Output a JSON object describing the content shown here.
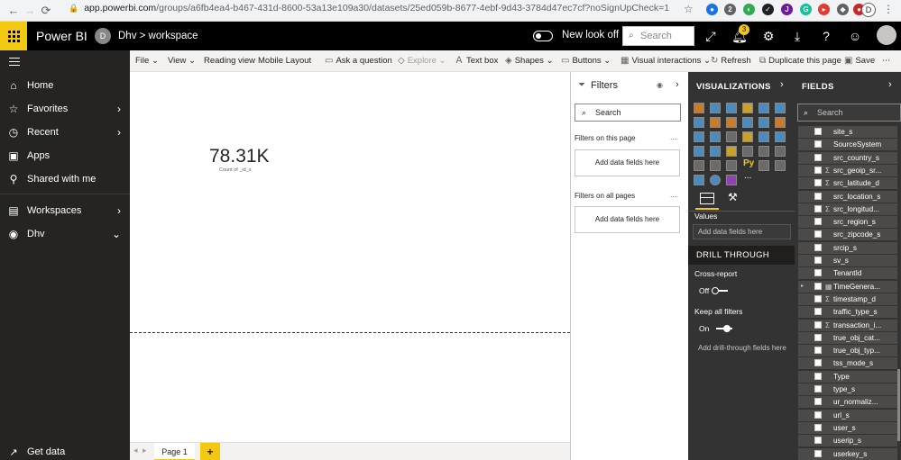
{
  "browser": {
    "url_host": "app.powerbi.com",
    "url_path": "/groups/a6fb4ea4-b467-431d-8600-53a13e109a30/datasets/25ed059b-8677-4ebf-9d43-3784d47ec7cf?noSignUpCheck=1",
    "profile_initial": "D",
    "extension_badge": "2"
  },
  "header": {
    "app_name": "Power BI",
    "workspace_avatar": "D",
    "breadcrumb": "Dhv  >  workspace",
    "new_look_label": "New look off",
    "search_placeholder": "Search",
    "notification_count": "3"
  },
  "leftnav": {
    "items": [
      {
        "label": "Home",
        "icon": "home-icon"
      },
      {
        "label": "Favorites",
        "icon": "star-icon"
      },
      {
        "label": "Recent",
        "icon": "clock-icon"
      },
      {
        "label": "Apps",
        "icon": "apps-icon"
      },
      {
        "label": "Shared with me",
        "icon": "shared-icon"
      },
      {
        "label": "Workspaces",
        "icon": "workspaces-icon"
      },
      {
        "label": "Dhv",
        "icon": "workspace-avatar-icon"
      }
    ],
    "get_data": "Get data"
  },
  "ribbon": {
    "file": "File",
    "view": "View",
    "reading_view": "Reading view",
    "mobile_layout": "Mobile Layout",
    "ask_question": "Ask a question",
    "explore": "Explore",
    "text_box": "Text box",
    "shapes": "Shapes",
    "buttons": "Buttons",
    "visual_interactions": "Visual interactions",
    "refresh": "Refresh",
    "duplicate_page": "Duplicate this page",
    "save": "Save"
  },
  "canvas": {
    "card_value": "78.31K",
    "card_label": "Count of _id_s",
    "page_tab": "Page 1",
    "add_page": "+"
  },
  "filters": {
    "title": "Filters",
    "search_placeholder": "Search",
    "on_this_page": "Filters on this page",
    "on_all_pages": "Filters on all pages",
    "add_fields": "Add data fields here",
    "more": "..."
  },
  "visualizations": {
    "title": "VISUALIZATIONS",
    "values_label": "Values",
    "values_placeholder": "Add data fields here",
    "drill_through": "DRILL THROUGH",
    "cross_report": "Cross-report",
    "cross_report_state": "Off",
    "keep_all_filters": "Keep all filters",
    "keep_all_filters_state": "On",
    "drill_placeholder": "Add drill-through fields here",
    "py_label": "Py",
    "more_visuals": "..."
  },
  "fields": {
    "title": "FIELDS",
    "search_placeholder": "Search",
    "items": [
      {
        "name": "site_s",
        "sigma": ""
      },
      {
        "name": "SourceSystem",
        "sigma": ""
      },
      {
        "name": "src_country_s",
        "sigma": ""
      },
      {
        "name": "src_geoip_sr...",
        "sigma": "Σ"
      },
      {
        "name": "src_latitude_d",
        "sigma": "Σ"
      },
      {
        "name": "src_location_s",
        "sigma": ""
      },
      {
        "name": "src_longitud...",
        "sigma": "Σ"
      },
      {
        "name": "src_region_s",
        "sigma": ""
      },
      {
        "name": "src_zipcode_s",
        "sigma": ""
      },
      {
        "name": "srcip_s",
        "sigma": ""
      },
      {
        "name": "sv_s",
        "sigma": ""
      },
      {
        "name": "TenantId",
        "sigma": ""
      },
      {
        "name": "TimeGenera...",
        "sigma": "▦",
        "expandable": true
      },
      {
        "name": "timestamp_d",
        "sigma": "Σ"
      },
      {
        "name": "traffic_type_s",
        "sigma": ""
      },
      {
        "name": "transaction_i...",
        "sigma": "Σ"
      },
      {
        "name": "true_obj_cat...",
        "sigma": ""
      },
      {
        "name": "true_obj_typ...",
        "sigma": ""
      },
      {
        "name": "tss_mode_s",
        "sigma": ""
      },
      {
        "name": "Type",
        "sigma": ""
      },
      {
        "name": "type_s",
        "sigma": ""
      },
      {
        "name": "ur_normaliz...",
        "sigma": ""
      },
      {
        "name": "url_s",
        "sigma": ""
      },
      {
        "name": "user_s",
        "sigma": ""
      },
      {
        "name": "userip_s",
        "sigma": ""
      },
      {
        "name": "userkey_s",
        "sigma": ""
      }
    ]
  },
  "colors": {
    "brand_yellow": "#f2c811",
    "header_bg": "#000000",
    "nav_bg": "#252423",
    "pane_bg": "#333333"
  }
}
